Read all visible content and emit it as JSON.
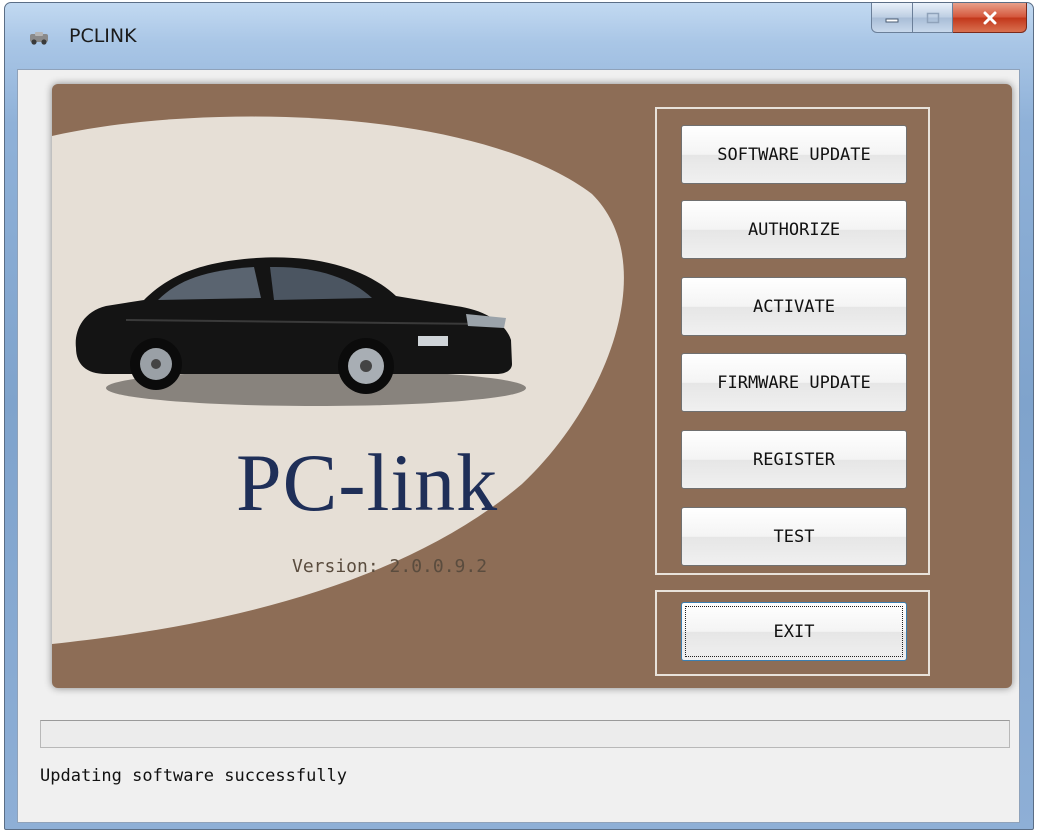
{
  "window": {
    "title": "PCLINK",
    "controls": {
      "minimize_icon": "minimize-icon",
      "maximize_icon": "maximize-icon",
      "close_icon": "close-icon"
    }
  },
  "banner": {
    "logo_text": "PC-link",
    "version_text": "Version: 2.0.0.9.2",
    "colors": {
      "background": "#8d6d56",
      "swoosh": "#e6dfd6",
      "logo": "#1f2f58"
    }
  },
  "buttons": {
    "software_update": "SOFTWARE UPDATE",
    "authorize": "AUTHORIZE",
    "activate": "ACTIVATE",
    "firmware_update": "FIRMWARE UPDATE",
    "register": "REGISTER",
    "test": "TEST",
    "exit": "EXIT"
  },
  "status": {
    "progress": 0,
    "message": "Updating software successfully"
  }
}
